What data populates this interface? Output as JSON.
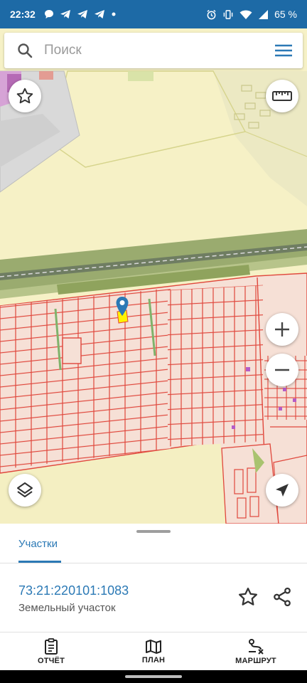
{
  "status_bar": {
    "time": "22:32",
    "battery": "65 %",
    "notification_icons": [
      "chat-bubble-icon",
      "telegram-icon",
      "telegram-icon",
      "telegram-icon",
      "dot-icon"
    ],
    "system_icons": [
      "alarm-icon",
      "vibrate-icon",
      "wifi-icon",
      "signal-icon"
    ]
  },
  "search": {
    "placeholder": "Поиск"
  },
  "map": {
    "colors": {
      "background": "#f6f1c6",
      "parcel_outline": "#e0473c",
      "railway_green": "#9aab6f",
      "marker": "#2b79b5",
      "highlight": "#fff200"
    }
  },
  "sheet": {
    "tab_label": "Участки",
    "cadastral_number": "73:21:220101:1083",
    "parcel_type": "Земельный участок"
  },
  "bottom_nav": {
    "items": [
      {
        "label": "ОТЧЁТ",
        "icon": "report-clipboard-icon"
      },
      {
        "label": "ПЛАН",
        "icon": "map-plan-icon"
      },
      {
        "label": "МАРШРУТ",
        "icon": "route-icon"
      }
    ]
  },
  "colors": {
    "status_bar": "#1d6aa6",
    "accent": "#2b79b5"
  }
}
